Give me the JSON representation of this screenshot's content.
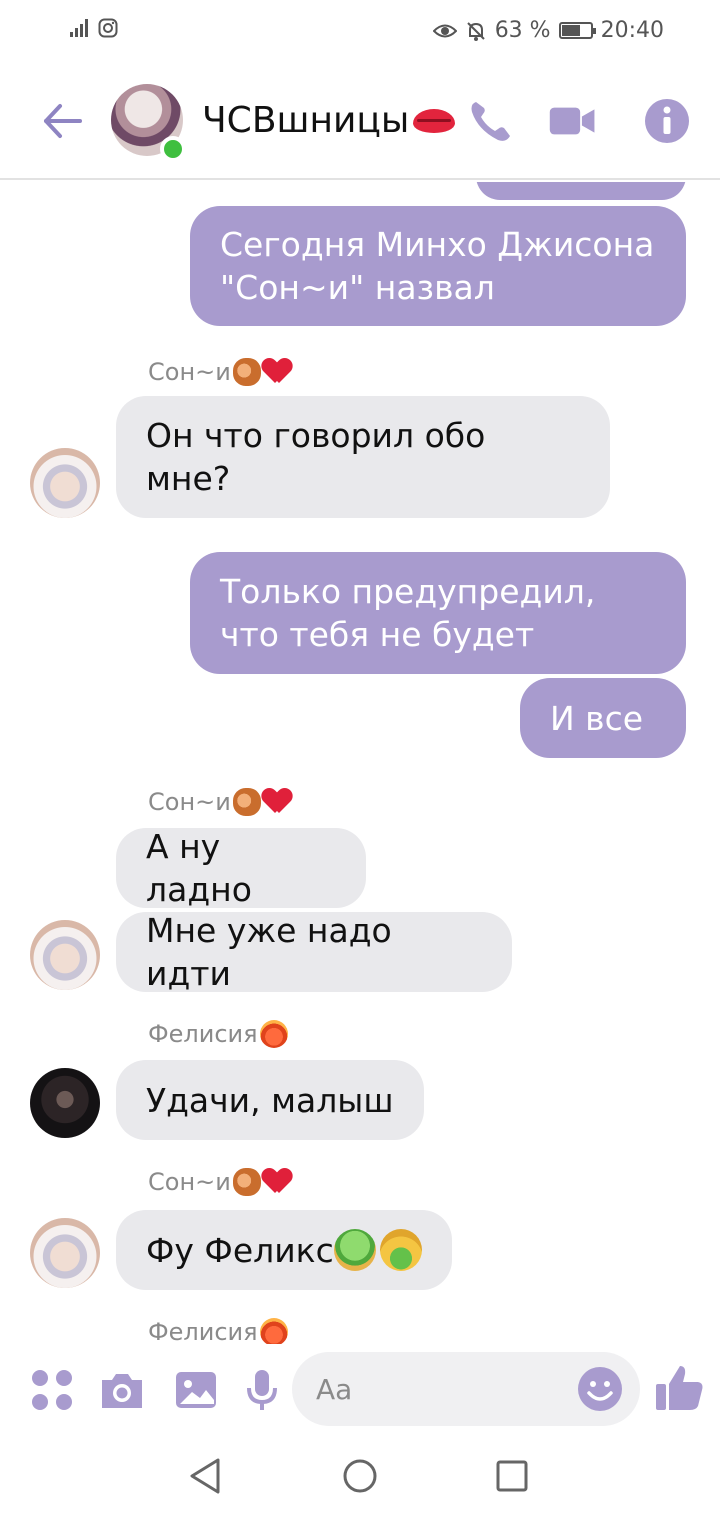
{
  "status_bar": {
    "battery_percent": "63 %",
    "battery_level": 0.63,
    "time": "20:40"
  },
  "header": {
    "title": "ЧСВшницы"
  },
  "messages": {
    "m0": "Сегодня Минхо Джисона \"Сон~и\" назвал",
    "s1": "Сон~и",
    "m1": "Он что говорил обо мне?",
    "m2": "Только предупредил, что тебя не будет",
    "m3": "И все",
    "s2": "Сон~и",
    "m4": "А ну ладно",
    "m5": "Мне уже надо идти",
    "s3": "Фелисия",
    "m6": "Удачи, малыш",
    "s4": "Сон~и",
    "m7": "Фу Феликс",
    "s5": "Фелисия"
  },
  "composer": {
    "placeholder": "Aa"
  },
  "colors": {
    "accent": "#a89bce",
    "incoming_bubble": "#e9e9ec",
    "online": "#3fbf3f"
  },
  "icons": [
    "back-arrow-icon",
    "phone-icon",
    "video-camera-icon",
    "info-icon",
    "apps-icon",
    "camera-icon",
    "image-icon",
    "microphone-icon",
    "smiley-icon",
    "thumbs-up-icon"
  ]
}
